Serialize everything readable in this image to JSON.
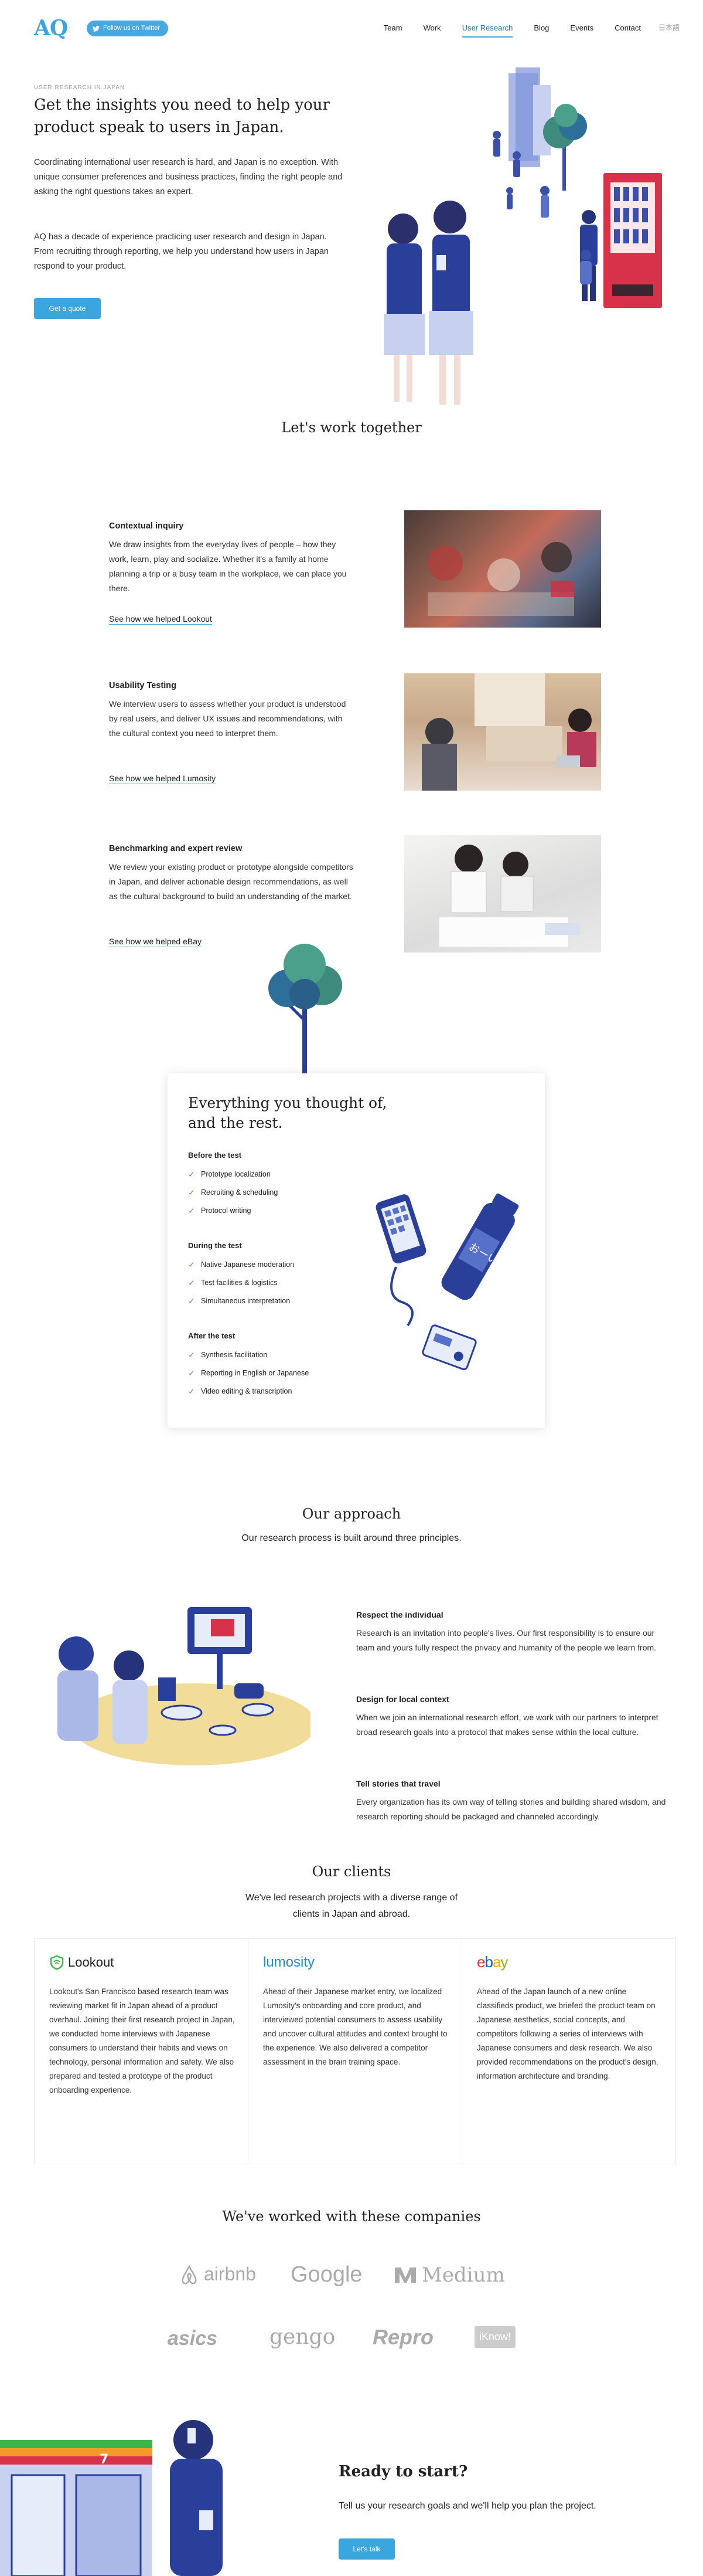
{
  "header": {
    "logo": "AQ",
    "twitter_label": "Follow us on Twitter",
    "nav": [
      "Team",
      "Work",
      "User Research",
      "Blog",
      "Events",
      "Contact"
    ],
    "active": "User Research",
    "lang": "日本語"
  },
  "hero": {
    "kicker": "USER RESEARCH IN JAPAN",
    "title": "Get the insights you need to help your product speak to users in Japan.",
    "p1": "Coordinating international user research is hard, and Japan is no exception. With unique consumer preferences and business practices, finding the right people and asking the right questions takes an expert.",
    "p2": "AQ has a decade of experience practicing user research and design in Japan. From recruiting through reporting, we help you understand how users in Japan respond to your product.",
    "cta": "Get a quote"
  },
  "work": {
    "title": "Let's work together",
    "services": [
      {
        "title": "Contextual inquiry",
        "text": "We draw insights from the everyday lives of people – how they work, learn, play and socialize. Whether it's a family at home planning a trip or a busy team in the workplace, we can place you there.",
        "link": "See how we helped Lookout"
      },
      {
        "title": "Usability Testing",
        "text": "We interview users to assess whether your product is understood by real users, and deliver UX issues and recommendations, with the cultural context you need to interpret them.",
        "link": "See how we helped Lumosity"
      },
      {
        "title": "Benchmarking and expert review",
        "text": "We review your existing product or prototype alongside competitors in Japan, and deliver actionable design recommendations, as well as the cultural background to build an understanding of the market.",
        "link": "See how we helped eBay"
      }
    ]
  },
  "checklist": {
    "title": "Everything you thought of, and the rest.",
    "groups": [
      {
        "title": "Before the test",
        "items": [
          "Prototype localization",
          "Recruiting & scheduling",
          "Protocol writing"
        ]
      },
      {
        "title": "During the test",
        "items": [
          "Native Japanese moderation",
          "Test facilities & logistics",
          "Simultaneous interpretation"
        ]
      },
      {
        "title": "After the test",
        "items": [
          "Synthesis facilitation",
          "Reporting in English or Japanese",
          "Video editing & transcription"
        ]
      }
    ]
  },
  "approach": {
    "title": "Our approach",
    "subtitle": "Our research process is built around three principles.",
    "principles": [
      {
        "title": "Respect the individual",
        "text": "Research is an invitation into people's lives. Our first responsibility is to ensure our team and yours fully respect the privacy and humanity of the people we learn from."
      },
      {
        "title": "Design for local context",
        "text": "When we join an international research effort, we work with our partners to interpret broad research goals into a protocol that makes sense within the local culture."
      },
      {
        "title": "Tell stories that travel",
        "text": "Every organization has its own way of telling stories and building shared wisdom, and research reporting should be packaged and channeled accordingly."
      }
    ]
  },
  "clients": {
    "title": "Our clients",
    "subtitle": "We've led research projects with a diverse range of clients in Japan and abroad.",
    "items": [
      {
        "logo": "Lookout",
        "text": "Lookout's San Francisco based research team was reviewing market fit in Japan ahead of a product overhaul. Joining their first research project in Japan, we conducted home interviews with Japanese consumers to understand their habits and views on technology, personal information and safety. We also prepared and tested a prototype of the product onboarding experience."
      },
      {
        "logo": "lumosity",
        "text": "Ahead of their Japanese market entry, we localized Lumosity's onboarding and core product, and interviewed potential consumers to assess usability and uncover cultural attitudes and context brought to the experience. We also delivered a competitor assessment in the brain training space."
      },
      {
        "logo": "ebay",
        "text": "Ahead of the Japan launch of a new online classifieds product, we briefed the product team on Japanese aesthetics, social concepts, and competitors following a series of interviews with Japanese consumers and desk research. We also provided recommendations on the product's design, information architecture and branding."
      }
    ]
  },
  "companies": {
    "title": "We've worked with these companies",
    "logos": [
      "airbnb",
      "Google",
      "Medium",
      "asics",
      "gengo",
      "Repro",
      "iKnow!"
    ]
  },
  "cta": {
    "title": "Ready to start?",
    "subtitle": "Tell us your research goals and we'll help you plan the project.",
    "button": "Let's talk"
  },
  "colors": {
    "accent": "#3aa6dd",
    "ink": "#2a3f9a",
    "check": "#6aa84f"
  }
}
